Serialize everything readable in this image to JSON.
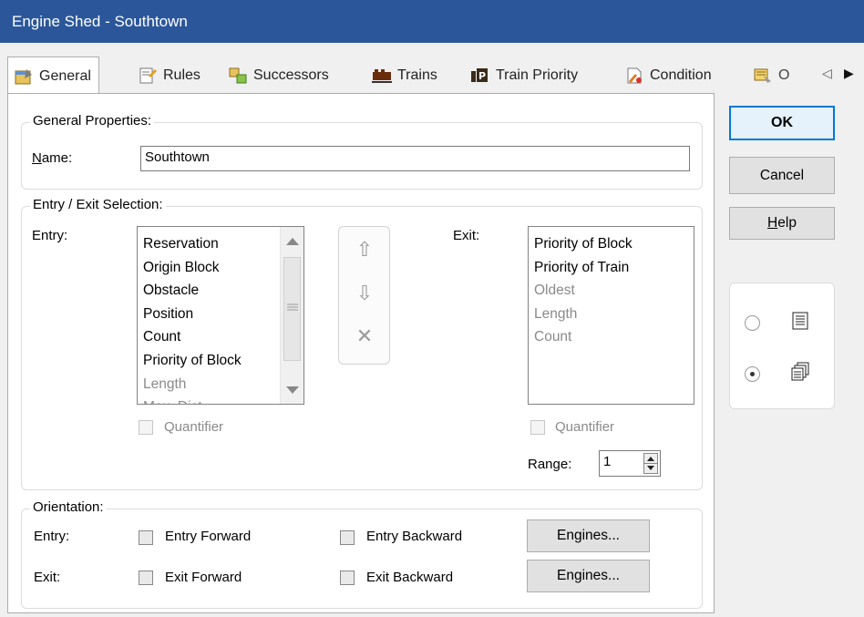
{
  "window": {
    "title": "Engine Shed - Southtown"
  },
  "tabs": [
    {
      "label": "General",
      "icon": "general-properties-icon"
    },
    {
      "label": "Rules",
      "icon": "rules-icon"
    },
    {
      "label": "Successors",
      "icon": "successors-icon"
    },
    {
      "label": "Trains",
      "icon": "trains-icon"
    },
    {
      "label": "Train Priority",
      "icon": "train-priority-icon"
    },
    {
      "label": "Condition",
      "icon": "condition-icon"
    },
    {
      "label": "O",
      "icon": "operations-icon"
    }
  ],
  "tab_scroll": {
    "left": "◁",
    "right": "▶"
  },
  "general": {
    "group_title": "General Properties:",
    "name_label_u": "N",
    "name_label_rest": "ame:",
    "name_value": "Southtown"
  },
  "entry_exit": {
    "group_title": "Entry / Exit Selection:",
    "entry_label": "Entry:",
    "exit_label": "Exit:",
    "entry_items": [
      {
        "text": "Reservation",
        "enabled": true
      },
      {
        "text": "Origin Block",
        "enabled": true
      },
      {
        "text": "Obstacle",
        "enabled": true
      },
      {
        "text": "Position",
        "enabled": true
      },
      {
        "text": "Count",
        "enabled": true
      },
      {
        "text": "Priority of Block",
        "enabled": true
      },
      {
        "text": "Length",
        "enabled": false
      },
      {
        "text": "Max. Dist...",
        "enabled": false
      }
    ],
    "exit_items": [
      {
        "text": "Priority of Block",
        "enabled": true
      },
      {
        "text": "Priority of Train",
        "enabled": true
      },
      {
        "text": "Oldest",
        "enabled": false
      },
      {
        "text": "Length",
        "enabled": false
      },
      {
        "text": "Count",
        "enabled": false
      }
    ],
    "move_up": "⇧",
    "move_down": "⇩",
    "remove": "✕",
    "entry_quantifier": "Quantifier",
    "exit_quantifier": "Quantifier",
    "range_label": "Range:",
    "range_value": "1"
  },
  "orientation": {
    "group_title": "Orientation:",
    "entry_label": "Entry:",
    "exit_label": "Exit:",
    "entry_forward": "Entry Forward",
    "entry_backward": "Entry Backward",
    "exit_forward": "Exit Forward",
    "exit_backward": "Exit Backward",
    "engines_button": "Engines..."
  },
  "buttons": {
    "ok": "OK",
    "cancel": "Cancel",
    "help_u": "H",
    "help_rest": "elp"
  },
  "view_mode": {
    "options": [
      "list-view-icon",
      "multi-page-view-icon"
    ],
    "selected": "multi-page-view-icon"
  }
}
